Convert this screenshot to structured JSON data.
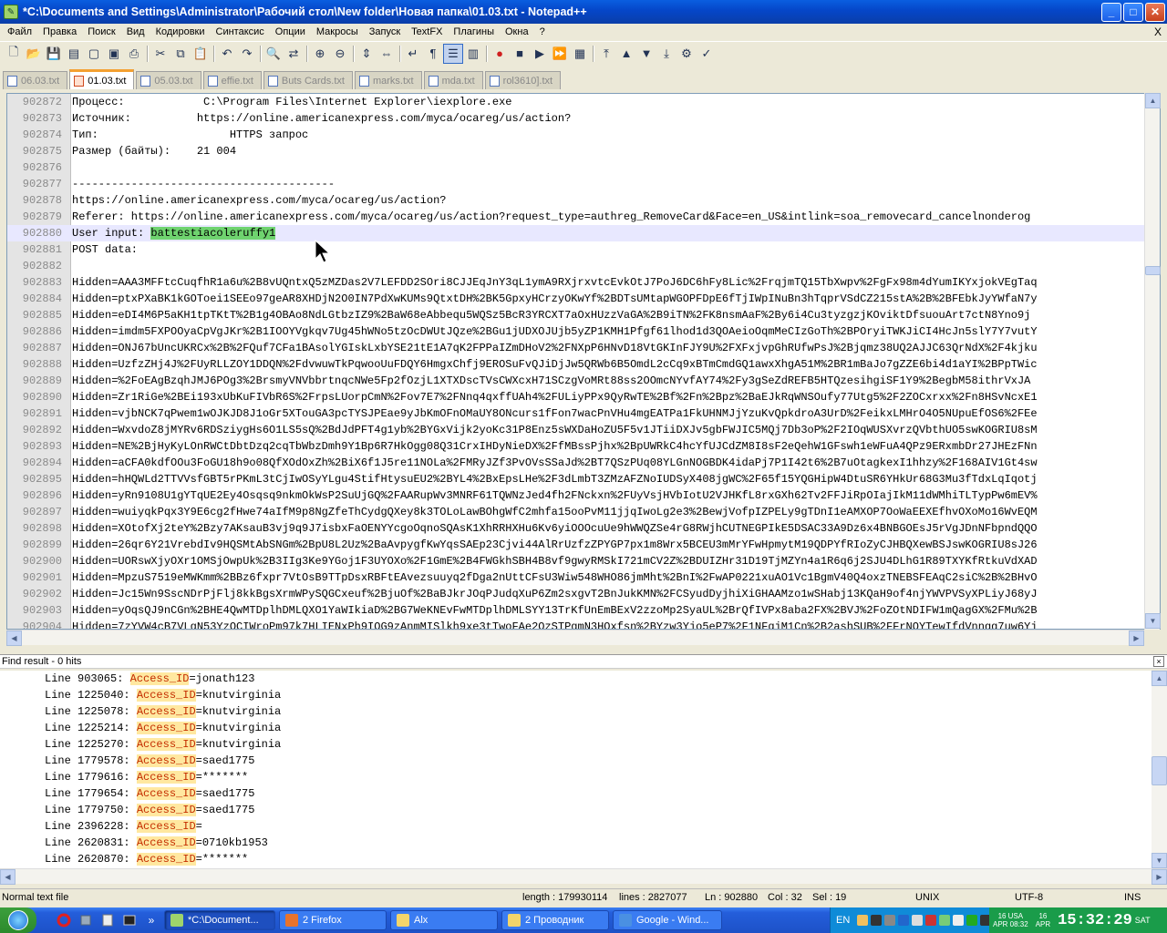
{
  "window": {
    "title": "*C:\\Documents and Settings\\Administrator\\Рабочий стол\\New folder\\Новая папка\\01.03.txt - Notepad++"
  },
  "menu": [
    "Файл",
    "Правка",
    "Поиск",
    "Вид",
    "Кодировки",
    "Синтаксис",
    "Опции",
    "Макросы",
    "Запуск",
    "TextFX",
    "Плагины",
    "Окна",
    "?"
  ],
  "menu_close": "X",
  "tabs": [
    {
      "label": "06.03.txt",
      "active": false
    },
    {
      "label": "01.03.txt",
      "active": true
    },
    {
      "label": "05.03.txt",
      "active": false
    },
    {
      "label": "effie.txt",
      "active": false
    },
    {
      "label": "Buts Cards.txt",
      "active": false
    },
    {
      "label": "marks.txt",
      "active": false
    },
    {
      "label": "mda.txt",
      "active": false
    },
    {
      "label": "rol3610].txt",
      "active": false
    }
  ],
  "editor": {
    "current_line": "902880",
    "selected_text": "battestiacoleruffy1",
    "lines": [
      {
        "n": "902872",
        "t": "Процесс:            C:\\Program Files\\Internet Explorer\\iexplore.exe"
      },
      {
        "n": "902873",
        "t": "Источник:          https://online.americanexpress.com/myca/ocareg/us/action?"
      },
      {
        "n": "902874",
        "t": "Тип:                    HTTPS запрос"
      },
      {
        "n": "902875",
        "t": "Размер (байты):    21 004"
      },
      {
        "n": "902876",
        "t": ""
      },
      {
        "n": "902877",
        "t": "----------------------------------------"
      },
      {
        "n": "902878",
        "t": "https://online.americanexpress.com/myca/ocareg/us/action?"
      },
      {
        "n": "902879",
        "t": "Referer: https://online.americanexpress.com/myca/ocareg/us/action?request_type=authreg_RemoveCard&Face=en_US&intlink=soa_removecard_cancelnonderog"
      },
      {
        "n": "902880",
        "t": "User input: ",
        "sel": "battestiacoleruffy1"
      },
      {
        "n": "902881",
        "t": "POST data:"
      },
      {
        "n": "902882",
        "t": ""
      },
      {
        "n": "902883",
        "t": "Hidden=AAA3MFFtcCuqfhR1a6u%2B8vUQntxQ5zMZDas2V7LEFDD2SOri8CJJEqJnY3qL1ymA9RXjrxvtcEvkOtJ7PoJ6DC6hFy8Lic%2FrqjmTQ15TbXwpv%2FgFx98m4dYumIKYxjokVEgTaq"
      },
      {
        "n": "902884",
        "t": "Hidden=ptxPXaBK1kGOToei1SEEo97geAR8XHDjN2O0IN7PdXwKUMs9QtxtDH%2BK5GpxyHCrzyOKwYf%2BDTsUMtapWGOPFDpE6fTjIWpINuBn3hTqprVSdCZ215stA%2B%2BFEbkJyYWfaN7y"
      },
      {
        "n": "902885",
        "t": "Hidden=eDI4M6P5aKH1tpTKtT%2B1g4OBAo8NdLGtbzIZ9%2BaW68eAbbequ5WQSz5BcR3YRCXT7aOxHUzzVaGA%2B9iTN%2FK8nsmAaF%2By6i4Cu3tyzgzjKOviktDfsuouArt7ctN8Yno9j"
      },
      {
        "n": "902886",
        "t": "Hidden=imdm5FXPOOyaCpVgJKr%2B1IOOYVgkqv7Ug45hWNo5tzOcDWUtJQze%2BGu1jUDXOJUjb5yZP1KMH1Pfgf61lhod1d3QOAeioOqmMeCIzGoTh%2BPOryiTWKJiCI4HcJn5slY7Y7vutY"
      },
      {
        "n": "902887",
        "t": "Hidden=ONJ67bUncUKRCx%2B%2FQuf7CFa1BAsolYGIskLxbYSE21tE1A7qK2FPPaIZmDHoV2%2FNXpP6HNvD18VtGKInFJY9U%2FXFxjvpGhRUfwPsJ%2Bjqmz38UQ2AJJC63QrNdX%2F4kjku"
      },
      {
        "n": "902888",
        "t": "Hidden=UzfzZHj4J%2FUyRLLZOY1DDQN%2FdvwuwTkPqwooUuFDQY6HmgxChfj9EROSuFvQJiDjJw5QRWb6B5OmdL2cCq9xBTmCmdGQ1awxXhgA51M%2BR1mBaJo7gZZE6bi4d1aYI%2BPpTWic"
      },
      {
        "n": "902889",
        "t": "Hidden=%2FoEAgBzqhJMJ6POg3%2BrsmyVNVbbrtnqcNWe5Fp2fOzjL1XTXDscTVsCWXcxH71SCzgVoMRt88ss2OOmcNYvfAY74%2Fy3gSeZdREFB5HTQzesihgiSF1Y9%2BegbM58ithrVxJA"
      },
      {
        "n": "902890",
        "t": "Hidden=Zr1RiGe%2BEi193xUbKuFIVbR6S%2FrpsLUorpCmN%2Fov7E7%2FNnq4qxffUAh4%2FULiyPPx9QyRwTE%2Bf%2Fn%2Bpz%2BaEJkRqWNSOufy77Utg5%2F2ZOCxrxx%2Fn8HSvNcxE1"
      },
      {
        "n": "902891",
        "t": "Hidden=vjbNCK7qPwem1wOJKJD8J1oGr5XTouGA3pcTYSJPEae9yJbKmOFnOMaUY8ONcurs1fFon7wacPnVHu4mgEATPa1FkUHNMJjYzuKvQpkdroA3UrD%2FeikxLMHrO4O5NUpuEfOS6%2FEe"
      },
      {
        "n": "902892",
        "t": "Hidden=WxvdoZ8jMYRv6RDSziygHs6O1LS5sQ%2BdJdPFT4g1yb%2BYGxVijk2yoKc31P8Enz5sWXDaHoZU5F5v1JTiiDXJv5gbFWJIC5MQj7Db3oP%2F2IOqWUSXvrzQVbthUO5swKOGRIU8sM"
      },
      {
        "n": "902893",
        "t": "Hidden=NE%2BjHyKyLOnRWCtDbtDzq2cqTbWbzDmh9Y1Bp6R7HkOgg08Q31CrxIHDyNieDX%2FfMBssPjhx%2BpUWRkC4hcYfUJCdZM8I8sF2eQehW1GFswh1eWFuA4QPz9ERxmbDr27JHEzFNn"
      },
      {
        "n": "902894",
        "t": "Hidden=aCFA0kdfOOu3FoGU18h9o08QfXOdOxZh%2BiX6f1J5re11NOLa%2FMRyJZf3PvOVsSSaJd%2BT7QSzPUq08YLGnNOGBDK4idaPj7P1I42t6%2B7uOtagkexI1hhzy%2F168AIV1Gt4sw"
      },
      {
        "n": "902895",
        "t": "Hidden=hHQWLd2TTVVsfGBT5rPKmL3tCjIwOSyYLgu4StifHtysuEU2%2BYL4%2BxEpsLHe%2F3dLmbT3ZMzAFZNoIUDSyX408jgWC%2F65f15YQGHipW4DtuSR6YHkUr68G3Mu3fTdxLqIqotj"
      },
      {
        "n": "902896",
        "t": "Hidden=yRn9108U1gYTqUE2Ey4Osqsq9nkmOkWsP2SuUjGQ%2FAARupWv3MNRF61TQWNzJed4fh2FNckxn%2FUyVsjHVbIotU2VJHKfL8rxGXh62Tv2FFJiRpOIajIkM11dWMhiTLTypPw6mEV%"
      },
      {
        "n": "902897",
        "t": "Hidden=wuiyqkPqx3Y9E6cg2fHwe74aIfM9p8NgZfeThCydgQXey8k3TOLoLawBOhgWfC2mhfa15ooPvM11jjqIwoLg2e3%2BewjVofpIZPELy9gTDnI1eAMXOP7OoWaEEXEfhvOXoMo16WvEQM"
      },
      {
        "n": "902898",
        "t": "Hidden=XOtofXj2teY%2Bzy7AKsauB3vj9q9J7isbxFaOENYYcgoOqnoSQAsK1XhRRHXHu6Kv6yiOOOcuUe9hWWQZSe4rG8RWjhCUTNEGPIkE5DSAC33A9Dz6x4BNBGOEsJ5rVgJDnNFbpndQQO"
      },
      {
        "n": "902899",
        "t": "Hidden=26qr6Y21VrebdIv9HQSMtAbSNGm%2BpU8L2Uz%2BaAvpygfKwYqsSAEp23Cjvi44AlRrUzfzZPYGP7px1m8Wrx5BCEU3mMrYFwHpmytM19QDPYfRIoZyCJHBQXewBSJswKOGRIU8sJ26"
      },
      {
        "n": "902900",
        "t": "Hidden=UORswXjyOXr1OMSjOwpUk%2B3IIg3Ke9YGoj1F3UYOXo%2F1GmE%2B4FWGkhSBH4B8vf9gwyRMSkI721mCV2Z%2BDUIZHr31D19TjMZYn4a1R6q6j2SJU4DLhG1R89TXYKfRtkuVdXAD"
      },
      {
        "n": "902901",
        "t": "Hidden=MpzuS7519eMWKmm%2BBz6fxpr7VtOsB9TTpDsxRBFtEAvezsuuyq2fDga2nUttCFsU3Wiw548WHO86jmMht%2BnI%2FwAP0221xuAO1Vc1BgmV40Q4oxzTNEBSFEAqC2siC%2B%2BHvO"
      },
      {
        "n": "902902",
        "t": "Hidden=Jc15Wn9SscNDrPjFlj8kkBgsXrmWPySQGCxeuf%2BjuOf%2BaBJkrJOqPJudqXuP6Zm2sxgvT2BnJukKMN%2FCSyudDyjhiXiGHAAMzo1wSHabj13KQaH9of4njYWVPVSyXPLiyJ68yJ"
      },
      {
        "n": "902903",
        "t": "Hidden=yOqsQJ9nCGn%2BHE4QwMTDplhDMLQXO1YaWIkiaD%2BG7WeKNEvFwMTDplhDMLSYY13TrKfUnEmBExV2zzoMp2SyaUL%2BrQfIVPx8aba2FX%2BVJ%2FoZOtNDIFW1mQagGX%2FMu%2B"
      },
      {
        "n": "902904",
        "t": "Hidden=7zYVW4cB7VLgN53YzOCIWroPm97k7HLIENxPh9IOG9zAnmMISlkh9xe3tTwoFAe2OzSTPgmN3HOxfsn%2BYzw3Yjo5eP7%2F1NFqjM1Cn%2B2ashSUB%2FFrNOYTewIfdVnngg7uw6Yj"
      }
    ]
  },
  "find_panel": {
    "header": "Find result - 0 hits",
    "results": [
      {
        "line": "Line 903065: ",
        "key": "Access_ID",
        "val": "=jonath123"
      },
      {
        "line": "Line 1225040: ",
        "key": "Access_ID",
        "val": "=knutvirginia"
      },
      {
        "line": "Line 1225078: ",
        "key": "Access_ID",
        "val": "=knutvirginia"
      },
      {
        "line": "Line 1225214: ",
        "key": "Access_ID",
        "val": "=knutvirginia"
      },
      {
        "line": "Line 1225270: ",
        "key": "Access_ID",
        "val": "=knutvirginia"
      },
      {
        "line": "Line 1779578: ",
        "key": "Access_ID",
        "val": "=saed1775"
      },
      {
        "line": "Line 1779616: ",
        "key": "Access_ID",
        "val": "=*******"
      },
      {
        "line": "Line 1779654: ",
        "key": "Access_ID",
        "val": "=saed1775"
      },
      {
        "line": "Line 1779750: ",
        "key": "Access_ID",
        "val": "=saed1775"
      },
      {
        "line": "Line 2396228: ",
        "key": "Access_ID",
        "val": "="
      },
      {
        "line": "Line 2620831: ",
        "key": "Access_ID",
        "val": "=0710kb1953"
      },
      {
        "line": "Line 2620870: ",
        "key": "Access_ID",
        "val": "=*******"
      }
    ]
  },
  "status": {
    "file_type": "Normal text file",
    "length": "length : 179930114",
    "lines": "lines : 2827077",
    "ln": "Ln : 902880",
    "col": "Col : 32",
    "sel": "Sel : 19",
    "eol": "UNIX",
    "encoding": "UTF-8",
    "mode": "INS"
  },
  "taskbar": {
    "tasks": [
      {
        "label": "*C:\\Document...",
        "active": true,
        "color": "#9fd36b"
      },
      {
        "label": "2 Firefox",
        "active": false,
        "color": "#e8732c"
      },
      {
        "label": "Alx",
        "active": false,
        "color": "#f3d56a"
      },
      {
        "label": "2 Проводник",
        "active": false,
        "color": "#f3d56a"
      },
      {
        "label": "Google - Wind...",
        "active": false,
        "color": "#4a90e2"
      }
    ],
    "lang": "EN",
    "date_left_1": "16 USA",
    "date_left_2": "APR 08:32",
    "date_right_1": "16",
    "date_right_2": "APR",
    "time": "15:32:29",
    "day": "SAT"
  },
  "colors": {
    "accent": "#0a5ee0",
    "selection": "#6fd36f",
    "find_highlight": "#ffe8a0",
    "find_text": "#c42d00"
  }
}
